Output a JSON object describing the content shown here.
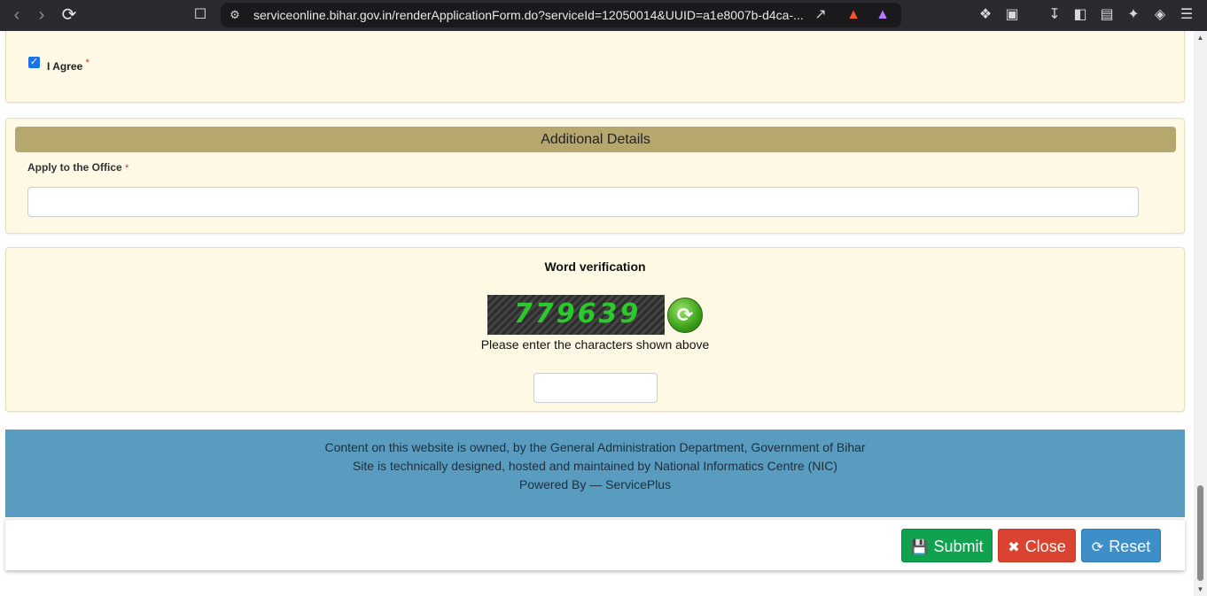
{
  "browser": {
    "url": "serviceonline.bihar.gov.in/renderApplicationForm.do?serviceId=12050014&UUID=a1e8007b-d4ca-..."
  },
  "consent": {
    "agree_label": "I Agree",
    "required_mark": "*",
    "checked": true
  },
  "additional_details": {
    "title": "Additional Details",
    "office_label": "Apply to the Office",
    "required_mark": "*",
    "office_value": ""
  },
  "word_verification": {
    "title": "Word verification",
    "captcha_text": "779639",
    "hint": "Please enter the characters shown above",
    "input_value": ""
  },
  "footer": {
    "line1": "Content on this website is owned, by the General Administration Department, Government of Bihar",
    "line2": "Site is technically designed, hosted and maintained by National Informatics Centre (NIC)",
    "line3": "Powered By — ServicePlus"
  },
  "actions": {
    "submit_label": "Submit",
    "close_label": "Close",
    "reset_label": "Reset"
  },
  "colors": {
    "panel_bg": "#fef9e4",
    "section_header": "#b6a76f",
    "footer_bg": "#599cc0",
    "submit": "#0fa34f",
    "close": "#d9432f",
    "reset": "#3e8ec8"
  }
}
